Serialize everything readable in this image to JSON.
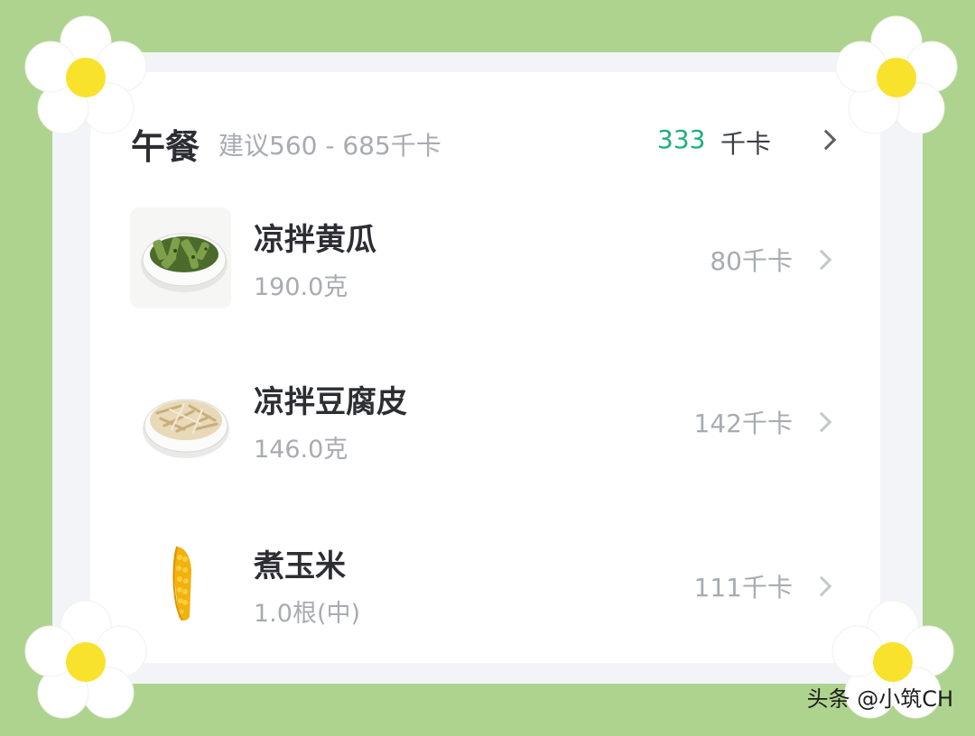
{
  "meal": {
    "title": "午餐",
    "suggestion": "建议560 - 685千卡",
    "total_value": "333",
    "total_unit": "千卡"
  },
  "foods": [
    {
      "name": "凉拌黄瓜",
      "quantity": "190.0克",
      "calories": "80千卡",
      "image_icon": "cucumber-salad-plate"
    },
    {
      "name": "凉拌豆腐皮",
      "quantity": "146.0克",
      "calories": "142千卡",
      "image_icon": "tofu-skin-salad-plate"
    },
    {
      "name": "煮玉米",
      "quantity": "1.0根(中)",
      "calories": "111千卡",
      "image_icon": "boiled-corn"
    }
  ],
  "watermark": "头条 @小筑CH",
  "colors": {
    "background": "#aed38e",
    "accent_green": "#1fae7a",
    "flower_center": "#f8e22b"
  }
}
